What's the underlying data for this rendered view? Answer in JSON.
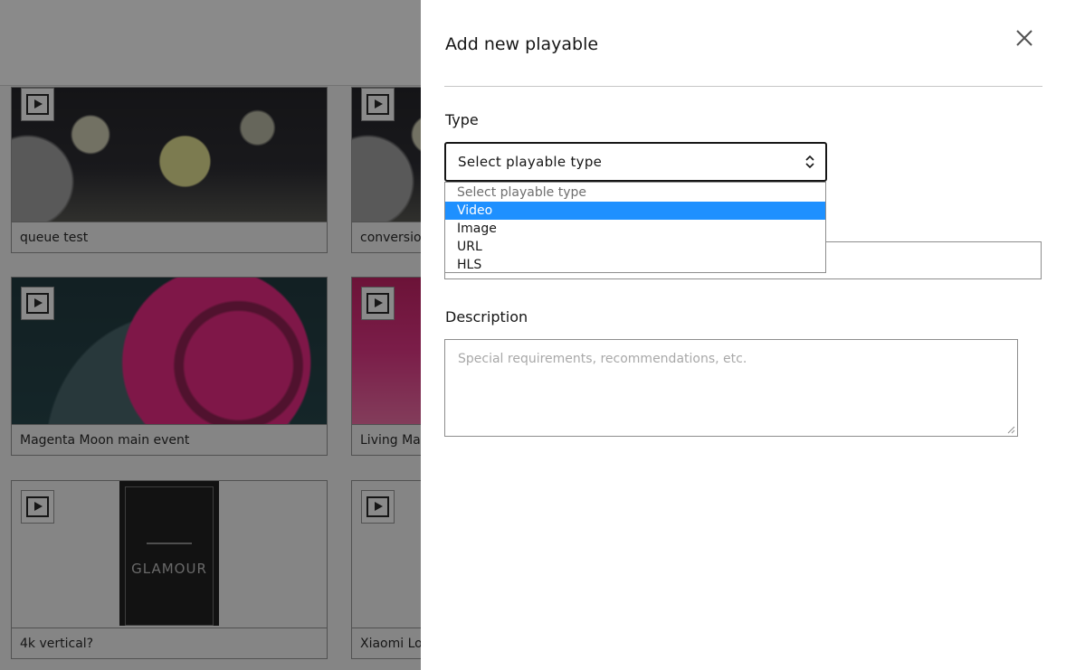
{
  "library": {
    "cards": [
      {
        "label": "queue test"
      },
      {
        "label": "conversio"
      },
      {
        "label": "Magenta Moon main event"
      },
      {
        "label": "Living Ma"
      },
      {
        "label": "4k vertical?"
      },
      {
        "label": "Xiaomi Lo"
      }
    ],
    "poster_text": "GLAMOUR"
  },
  "panel": {
    "title": "Add new playable",
    "type_label": "Type",
    "type_select": {
      "value": "Select playable type",
      "options": [
        {
          "label": "Select playable type"
        },
        {
          "label": "Video"
        },
        {
          "label": "Image"
        },
        {
          "label": "URL"
        },
        {
          "label": "HLS"
        }
      ],
      "highlighted": "Video"
    },
    "description_label": "Description",
    "description_placeholder": "Special requirements, recommendations, etc."
  },
  "colors": {
    "highlight": "#1e90ff",
    "overlay": "rgba(22,22,22,0.5)"
  }
}
